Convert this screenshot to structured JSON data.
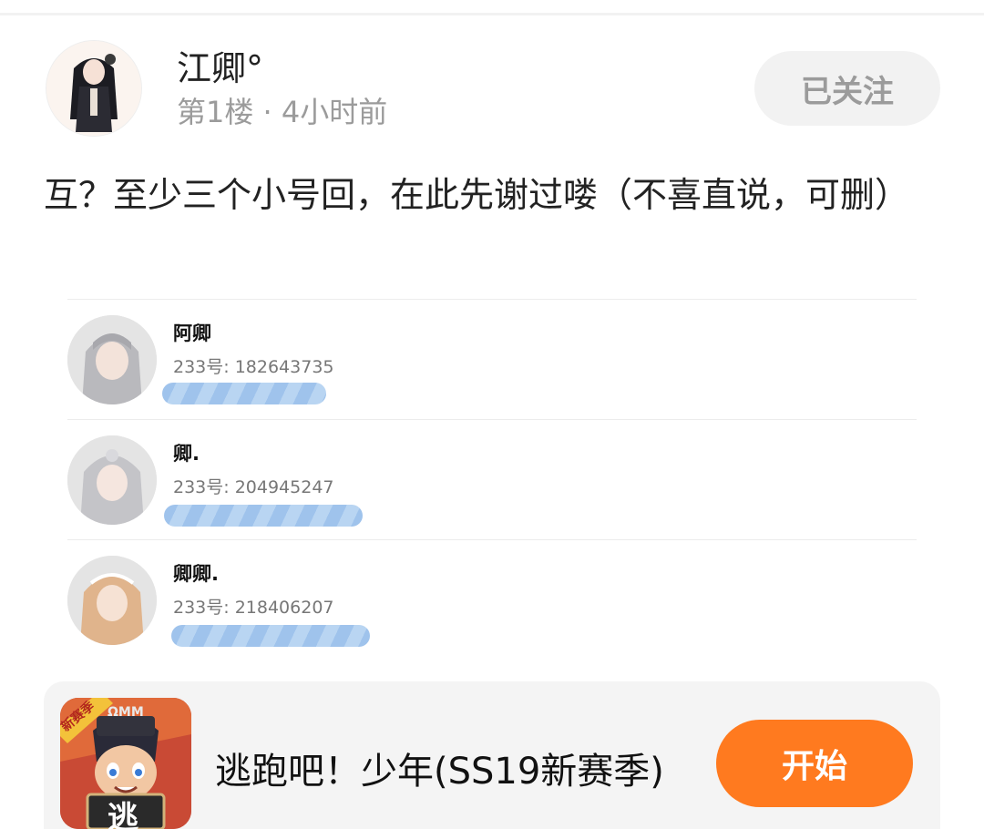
{
  "post": {
    "username": "江卿°",
    "meta": "第1楼 · 4小时前",
    "follow_label": "已关注",
    "content": "互？至少三个小号回，在此先谢过喽（不喜直说，可删）"
  },
  "friends": [
    {
      "name": "阿卿",
      "id_text": "233号: 182643735"
    },
    {
      "name": "卿.",
      "id_text": "233号: 204945247"
    },
    {
      "name": "卿卿.",
      "id_text": "233号: 218406207"
    }
  ],
  "ad": {
    "badge": "新赛季",
    "icon_char": "逃",
    "icon_cap": "ΩMM",
    "title": "逃跑吧！少年(SS19新赛季)",
    "button_label": "开始"
  },
  "colors": {
    "accent": "#ff7a1f",
    "muted_text": "#9b9b9b",
    "redaction": "#9fc3ec"
  }
}
